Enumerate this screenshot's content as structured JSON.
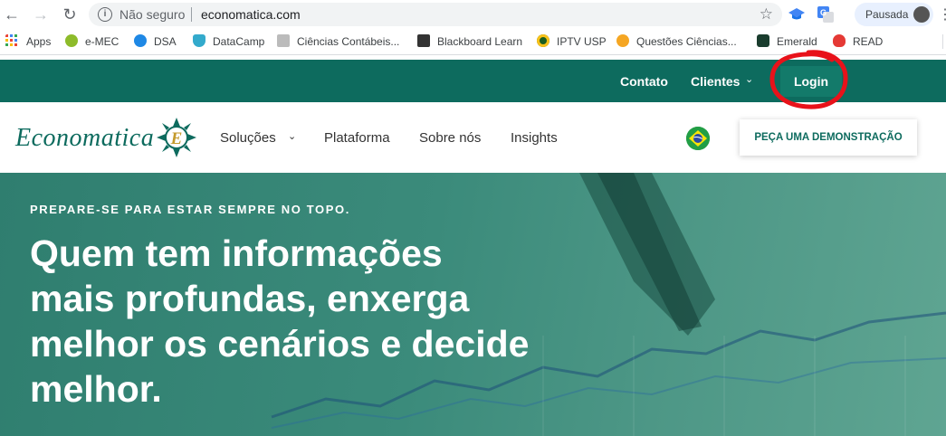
{
  "browser": {
    "security_label": "Não seguro",
    "url": "economatica.com",
    "profile_label": "Pausada",
    "bookmarks": [
      {
        "label": "Apps",
        "icon": "apps-grid-icon",
        "color": "#4285f4"
      },
      {
        "label": "e-MEC",
        "icon": "emec-icon",
        "color": "#8dbb2a"
      },
      {
        "label": "DSA",
        "icon": "dsa-icon",
        "color": "#1e88e5"
      },
      {
        "label": "DataCamp",
        "icon": "datacamp-icon",
        "color": "#3ac"
      },
      {
        "label": "Ciências Contábeis...",
        "icon": "bookmark-page-icon",
        "color": "#888888"
      },
      {
        "label": "Blackboard Learn",
        "icon": "blackboard-icon",
        "color": "#333333"
      },
      {
        "label": "IPTV USP",
        "icon": "iptv-icon",
        "color": "#1b5e20"
      },
      {
        "label": "Questões Ciências...",
        "icon": "questoes-icon",
        "color": "#f5a623"
      },
      {
        "label": "Emerald",
        "icon": "emerald-icon",
        "color": "#1a3d2e"
      },
      {
        "label": "READ",
        "icon": "read-icon",
        "color": "#e53935"
      }
    ]
  },
  "topbar": {
    "contact": "Contato",
    "clients": "Clientes",
    "login": "Login",
    "background": "#0d6b5e"
  },
  "mainnav": {
    "logo": "Economatica",
    "logo_letter": "E",
    "items": [
      "Soluções",
      "Plataforma",
      "Sobre nós",
      "Insights"
    ],
    "cta": "PEÇA UMA DEMONSTRAÇÃO"
  },
  "hero": {
    "kicker": "PREPARE-SE PARA ESTAR SEMPRE NO TOPO.",
    "headline_lines": [
      "Quem tem informações",
      "mais profundas, enxerga",
      "melhor os cenários e decide",
      "melhor."
    ]
  },
  "annotation": {
    "color": "#e8121a"
  }
}
